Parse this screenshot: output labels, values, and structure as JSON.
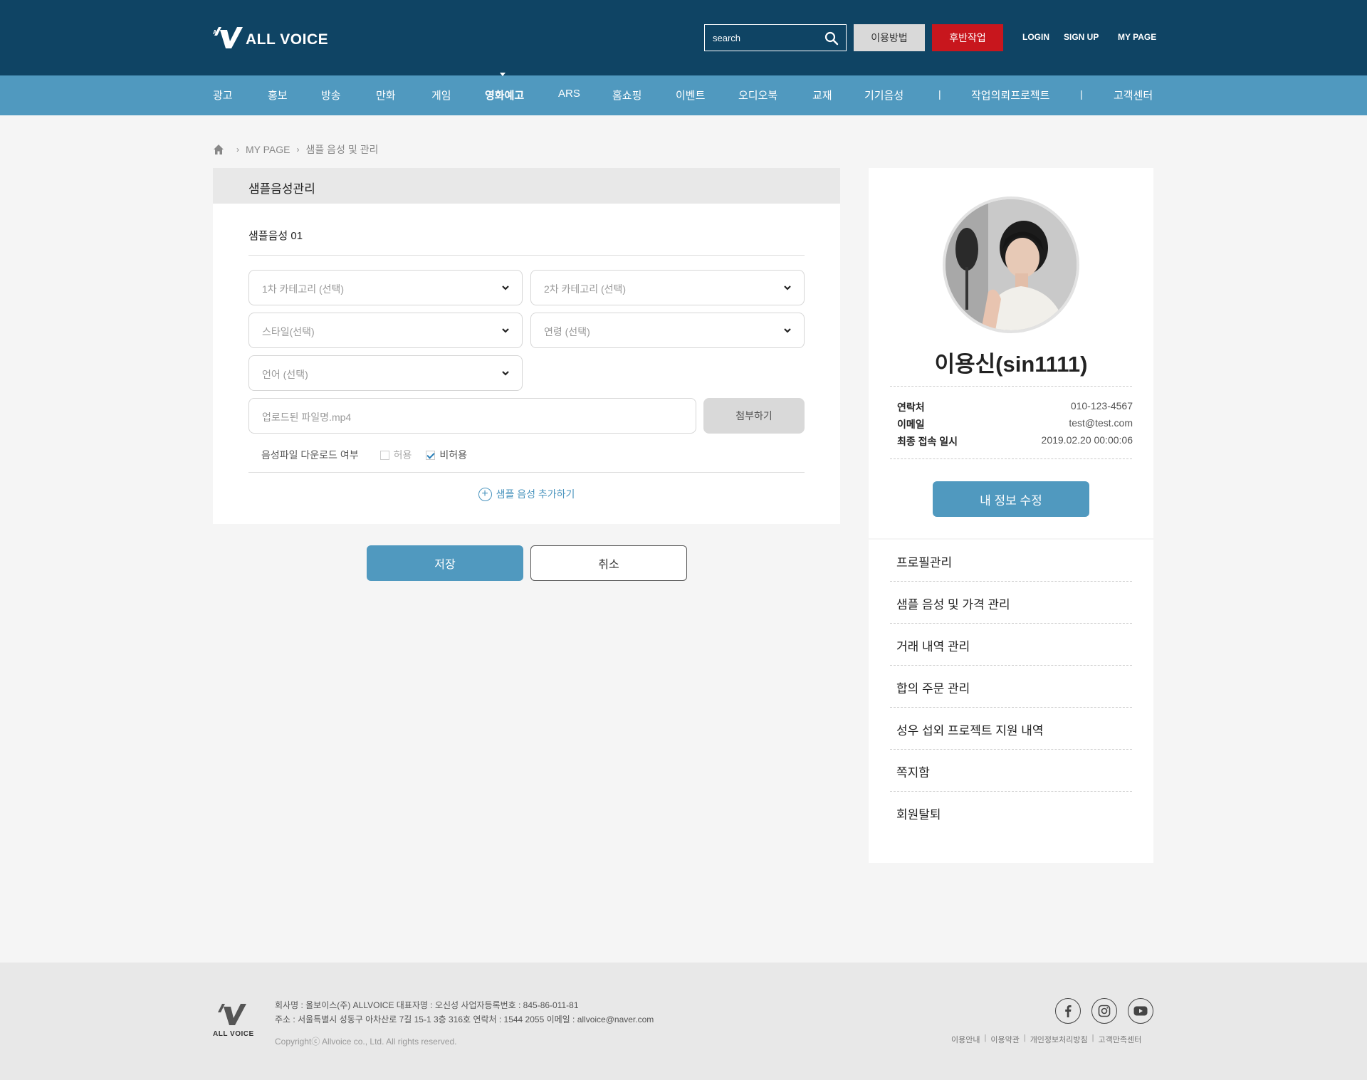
{
  "header": {
    "logo_text": "ALL VOICE",
    "search_placeholder": "search",
    "guide_button": "이용방법",
    "post_button": "후반작업",
    "login": "LOGIN",
    "signup": "SIGN UP",
    "mypage": "MY PAGE"
  },
  "nav": {
    "items": [
      "광고",
      "홍보",
      "방송",
      "만화",
      "게임",
      "영화예고",
      "ARS",
      "홈쇼핑",
      "이벤트",
      "오디오북",
      "교재",
      "기기음성"
    ],
    "active": "영화예고",
    "separator": "|",
    "project_request": "작업의뢰프로젝트",
    "customer_center": "고객센터"
  },
  "breadcrumb": {
    "level1": "MY PAGE",
    "level2": "샘플 음성 및 관리"
  },
  "form": {
    "panel_title": "샘플음성관리",
    "sample_title": "샘플음성 01",
    "category1_placeholder": "1차 카테고리 (선택)",
    "category2_placeholder": "2차 카테고리 (선택)",
    "style_placeholder": "스타일(선택)",
    "age_placeholder": "연령 (선택)",
    "language_placeholder": "언어 (선택)",
    "file_placeholder": "업로드된 파일명.mp4",
    "attach_button": "첨부하기",
    "download_label": "음성파일 다운로드 여부",
    "allow_label": "허용",
    "deny_label": "비허용",
    "allow_checked": false,
    "deny_checked": true,
    "add_sample": "샘플 음성 추가하기",
    "save_button": "저장",
    "cancel_button": "취소"
  },
  "profile": {
    "name": "이용신(sin1111)",
    "contact_label": "연락처",
    "contact_value": "010-123-4567",
    "email_label": "이메일",
    "email_value": "test@test.com",
    "last_login_label": "최종 접속 일시",
    "last_login_value": "2019.02.20 00:00:06",
    "edit_button": "내 정보 수정"
  },
  "sidebar_menu": [
    "프로필관리",
    "샘플 음성 및 가격 관리",
    "거래 내역 관리",
    "합의 주문 관리",
    "성우 섭외 프로젝트 지원 내역",
    "쪽지함",
    "회원탈퇴"
  ],
  "footer": {
    "logo_label": "ALL VOICE",
    "line1": "회사명 : 올보이스(주) ALLVOICE  대표자명 : 오신성  사업자등록번호 : 845-86-011-81",
    "line2": "주소 : 서울특별시 성동구 아차산로 7길 15-1 3층 316호  연락처 : 1544 2055  이메일 : allvoice@naver.com",
    "copyright": "Copyrightⓒ Allvoice co., Ltd. All rights reserved.",
    "links": [
      "이용안내",
      "이용약관",
      "개인정보처리방침",
      "고객만족센터"
    ]
  },
  "colors": {
    "header_bg": "#0f4464",
    "nav_bg": "#5099bf",
    "accent": "#5099bf",
    "post_button": "#c8161d"
  }
}
